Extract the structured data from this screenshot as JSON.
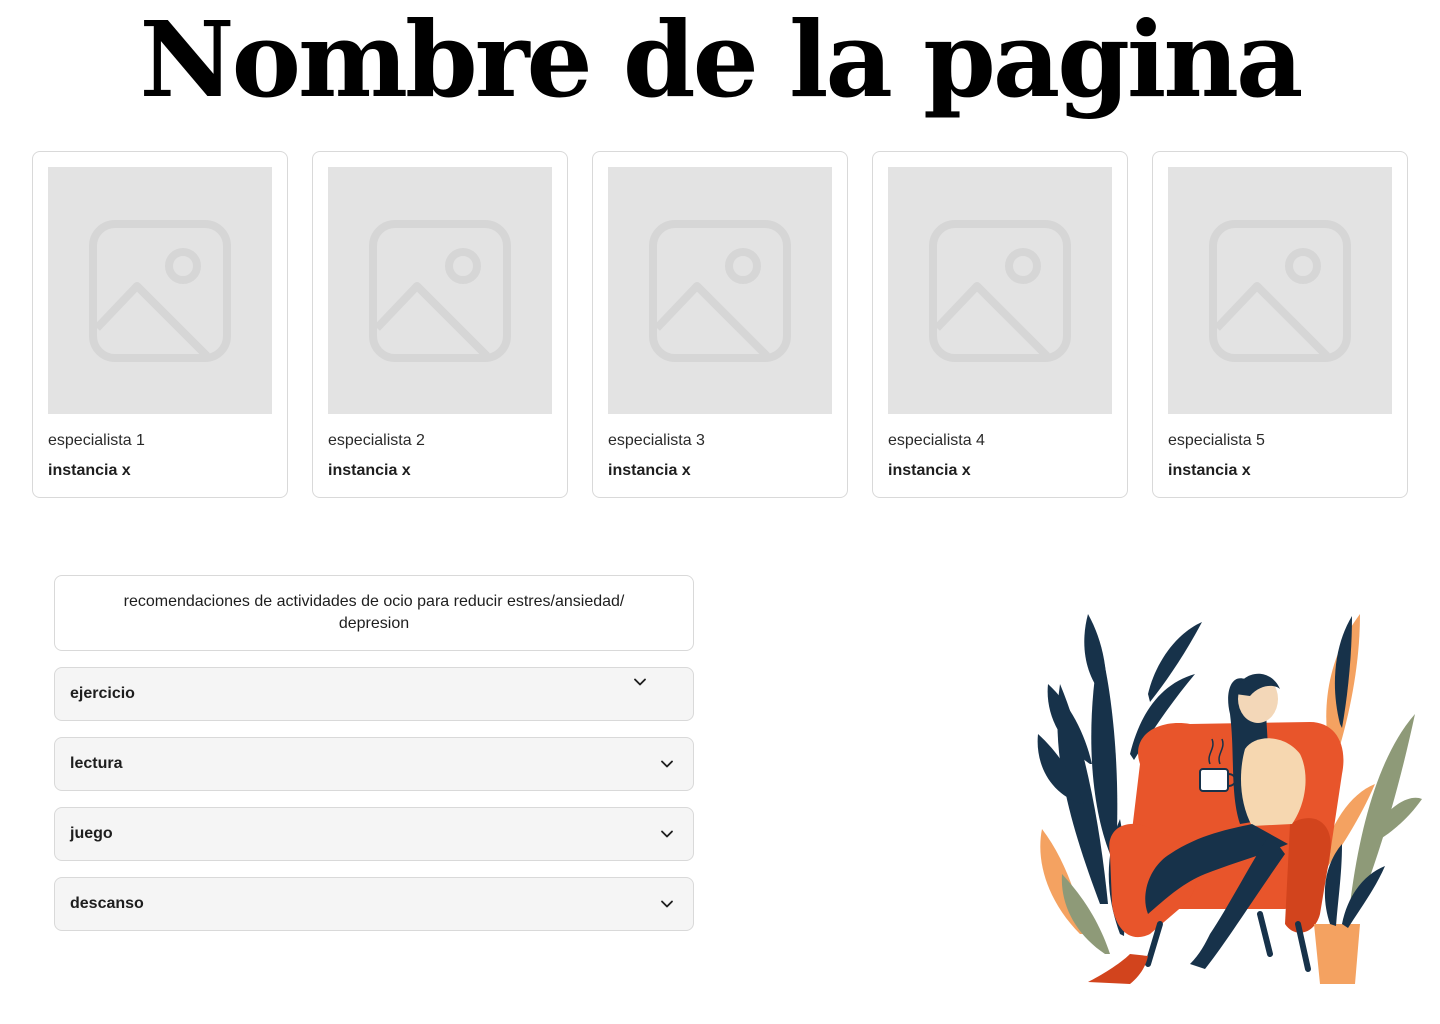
{
  "header": {
    "title": "Nombre de la pagina"
  },
  "specialists": [
    {
      "name": "especialista 1",
      "instance": "instancia x"
    },
    {
      "name": "especialista 2",
      "instance": "instancia x"
    },
    {
      "name": "especialista 3",
      "instance": "instancia x"
    },
    {
      "name": "especialista 4",
      "instance": "instancia x"
    },
    {
      "name": "especialista 5",
      "instance": "instancia x"
    }
  ],
  "recommendations": {
    "title": "recomendaciones de actividades de ocio para reducir estres/ansiedad/ depresion",
    "items": [
      {
        "label": "ejercicio",
        "icon": "chevron-down-icon"
      },
      {
        "label": "lectura",
        "icon": "chevron-down-icon"
      },
      {
        "label": "juego",
        "icon": "chevron-down-icon"
      },
      {
        "label": "descanso",
        "icon": "chevron-down-icon"
      }
    ]
  },
  "colors": {
    "placeholder_bg": "#e3e3e3",
    "border": "#d9d9d9",
    "accordion_bg": "#f5f5f5",
    "armchair": "#e8552b",
    "navy": "#17324a",
    "sage": "#8e9a78",
    "peach": "#f4a261"
  },
  "illustration": {
    "subject": "woman-reading-with-coffee-in-armchair"
  }
}
